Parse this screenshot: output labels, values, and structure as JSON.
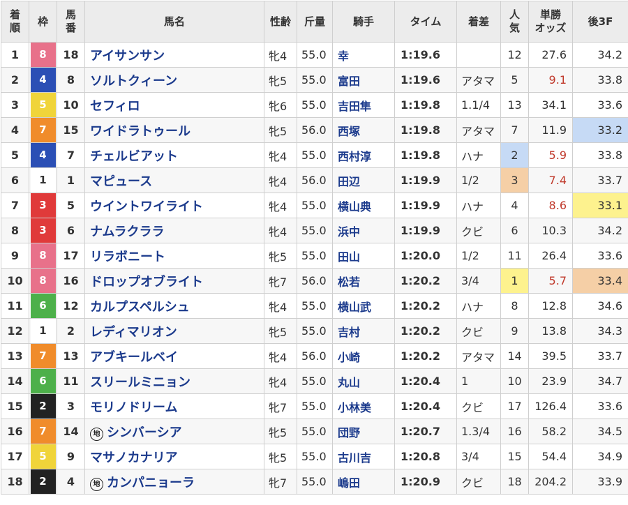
{
  "headers": {
    "rank": [
      "着",
      "順"
    ],
    "waku": "枠",
    "umaban": [
      "馬",
      "番"
    ],
    "horse": "馬名",
    "sex_age": "性齢",
    "weight": "斤量",
    "jockey": "騎手",
    "time": "タイム",
    "margin": "着差",
    "popularity": [
      "人",
      "気"
    ],
    "odds": [
      "単勝",
      "オッズ"
    ],
    "last3f": "後3F"
  },
  "chi_mark": "地",
  "waku_colors": {
    "1": {
      "bg": "#ffffff",
      "fg": "#333333"
    },
    "2": {
      "bg": "#222222",
      "fg": "#ffffff"
    },
    "3": {
      "bg": "#e03a3a",
      "fg": "#ffffff"
    },
    "4": {
      "bg": "#2b4fb5",
      "fg": "#ffffff"
    },
    "5": {
      "bg": "#f0d43a",
      "fg": "#ffffff"
    },
    "6": {
      "bg": "#4db04a",
      "fg": "#ffffff"
    },
    "7": {
      "bg": "#f08c2b",
      "fg": "#ffffff"
    },
    "8": {
      "bg": "#e8718a",
      "fg": "#ffffff"
    }
  },
  "highlight_colors": {
    "first": "#fdf28e",
    "second": "#c6daf5",
    "third": "#f5cfa6",
    "odds_red": "#c0392b"
  },
  "rows": [
    {
      "rank": "1",
      "waku": "8",
      "umaban": "18",
      "horse": "アイサンサン",
      "chi": false,
      "sex_age": "牝4",
      "weight": "55.0",
      "jockey": "幸",
      "time": "1:19.6",
      "margin": "",
      "pop": "12",
      "odds": "27.6",
      "odds_red": false,
      "last3f": "34.2",
      "pop_hl": "",
      "f3_hl": ""
    },
    {
      "rank": "2",
      "waku": "4",
      "umaban": "8",
      "horse": "ソルトクィーン",
      "chi": false,
      "sex_age": "牝5",
      "weight": "55.0",
      "jockey": "富田",
      "time": "1:19.6",
      "margin": "アタマ",
      "pop": "5",
      "odds": "9.1",
      "odds_red": true,
      "last3f": "33.8",
      "pop_hl": "",
      "f3_hl": ""
    },
    {
      "rank": "3",
      "waku": "5",
      "umaban": "10",
      "horse": "セフィロ",
      "chi": false,
      "sex_age": "牝6",
      "weight": "55.0",
      "jockey": "吉田隼",
      "time": "1:19.8",
      "margin": "1.1/4",
      "pop": "13",
      "odds": "34.1",
      "odds_red": false,
      "last3f": "33.6",
      "pop_hl": "",
      "f3_hl": ""
    },
    {
      "rank": "4",
      "waku": "7",
      "umaban": "15",
      "horse": "ワイドラトゥール",
      "chi": false,
      "sex_age": "牝5",
      "weight": "56.0",
      "jockey": "西塚",
      "time": "1:19.8",
      "margin": "アタマ",
      "pop": "7",
      "odds": "11.9",
      "odds_red": false,
      "last3f": "33.2",
      "pop_hl": "",
      "f3_hl": "second"
    },
    {
      "rank": "5",
      "waku": "4",
      "umaban": "7",
      "horse": "チェルビアット",
      "chi": false,
      "sex_age": "牝4",
      "weight": "55.0",
      "jockey": "西村淳",
      "time": "1:19.8",
      "margin": "ハナ",
      "pop": "2",
      "odds": "5.9",
      "odds_red": true,
      "last3f": "33.8",
      "pop_hl": "second",
      "f3_hl": ""
    },
    {
      "rank": "6",
      "waku": "1",
      "umaban": "1",
      "horse": "マピュース",
      "chi": false,
      "sex_age": "牝4",
      "weight": "56.0",
      "jockey": "田辺",
      "time": "1:19.9",
      "margin": "1/2",
      "pop": "3",
      "odds": "7.4",
      "odds_red": true,
      "last3f": "33.7",
      "pop_hl": "third",
      "f3_hl": ""
    },
    {
      "rank": "7",
      "waku": "3",
      "umaban": "5",
      "horse": "ウイントワイライト",
      "chi": false,
      "sex_age": "牝4",
      "weight": "55.0",
      "jockey": "横山典",
      "time": "1:19.9",
      "margin": "ハナ",
      "pop": "4",
      "odds": "8.6",
      "odds_red": true,
      "last3f": "33.1",
      "pop_hl": "",
      "f3_hl": "first"
    },
    {
      "rank": "8",
      "waku": "3",
      "umaban": "6",
      "horse": "ナムラクララ",
      "chi": false,
      "sex_age": "牝4",
      "weight": "55.0",
      "jockey": "浜中",
      "time": "1:19.9",
      "margin": "クビ",
      "pop": "6",
      "odds": "10.3",
      "odds_red": false,
      "last3f": "34.2",
      "pop_hl": "",
      "f3_hl": ""
    },
    {
      "rank": "9",
      "waku": "8",
      "umaban": "17",
      "horse": "リラボニート",
      "chi": false,
      "sex_age": "牝5",
      "weight": "55.0",
      "jockey": "田山",
      "time": "1:20.0",
      "margin": "1/2",
      "pop": "11",
      "odds": "26.4",
      "odds_red": false,
      "last3f": "33.6",
      "pop_hl": "",
      "f3_hl": ""
    },
    {
      "rank": "10",
      "waku": "8",
      "umaban": "16",
      "horse": "ドロップオブライト",
      "chi": false,
      "sex_age": "牝7",
      "weight": "56.0",
      "jockey": "松若",
      "time": "1:20.2",
      "margin": "3/4",
      "pop": "1",
      "odds": "5.7",
      "odds_red": true,
      "last3f": "33.4",
      "pop_hl": "first",
      "f3_hl": "third"
    },
    {
      "rank": "11",
      "waku": "6",
      "umaban": "12",
      "horse": "カルプスペルシュ",
      "chi": false,
      "sex_age": "牝4",
      "weight": "55.0",
      "jockey": "横山武",
      "time": "1:20.2",
      "margin": "ハナ",
      "pop": "8",
      "odds": "12.8",
      "odds_red": false,
      "last3f": "34.6",
      "pop_hl": "",
      "f3_hl": ""
    },
    {
      "rank": "12",
      "waku": "1",
      "umaban": "2",
      "horse": "レディマリオン",
      "chi": false,
      "sex_age": "牝5",
      "weight": "55.0",
      "jockey": "吉村",
      "time": "1:20.2",
      "margin": "クビ",
      "pop": "9",
      "odds": "13.8",
      "odds_red": false,
      "last3f": "34.3",
      "pop_hl": "",
      "f3_hl": ""
    },
    {
      "rank": "13",
      "waku": "7",
      "umaban": "13",
      "horse": "アブキールベイ",
      "chi": false,
      "sex_age": "牝4",
      "weight": "56.0",
      "jockey": "小崎",
      "time": "1:20.2",
      "margin": "アタマ",
      "pop": "14",
      "odds": "39.5",
      "odds_red": false,
      "last3f": "33.7",
      "pop_hl": "",
      "f3_hl": ""
    },
    {
      "rank": "14",
      "waku": "6",
      "umaban": "11",
      "horse": "スリールミニョン",
      "chi": false,
      "sex_age": "牝4",
      "weight": "55.0",
      "jockey": "丸山",
      "time": "1:20.4",
      "margin": "1",
      "pop": "10",
      "odds": "23.9",
      "odds_red": false,
      "last3f": "34.7",
      "pop_hl": "",
      "f3_hl": ""
    },
    {
      "rank": "15",
      "waku": "2",
      "umaban": "3",
      "horse": "モリノドリーム",
      "chi": false,
      "sex_age": "牝7",
      "weight": "55.0",
      "jockey": "小林美",
      "time": "1:20.4",
      "margin": "クビ",
      "pop": "17",
      "odds": "126.4",
      "odds_red": false,
      "last3f": "33.6",
      "pop_hl": "",
      "f3_hl": ""
    },
    {
      "rank": "16",
      "waku": "7",
      "umaban": "14",
      "horse": "シンバーシア",
      "chi": true,
      "sex_age": "牝5",
      "weight": "55.0",
      "jockey": "団野",
      "time": "1:20.7",
      "margin": "1.3/4",
      "pop": "16",
      "odds": "58.2",
      "odds_red": false,
      "last3f": "34.5",
      "pop_hl": "",
      "f3_hl": ""
    },
    {
      "rank": "17",
      "waku": "5",
      "umaban": "9",
      "horse": "マサノカナリア",
      "chi": false,
      "sex_age": "牝5",
      "weight": "55.0",
      "jockey": "古川吉",
      "time": "1:20.8",
      "margin": "3/4",
      "pop": "15",
      "odds": "54.4",
      "odds_red": false,
      "last3f": "34.9",
      "pop_hl": "",
      "f3_hl": ""
    },
    {
      "rank": "18",
      "waku": "2",
      "umaban": "4",
      "horse": "カンパニョーラ",
      "chi": true,
      "sex_age": "牝7",
      "weight": "55.0",
      "jockey": "嶋田",
      "time": "1:20.9",
      "margin": "クビ",
      "pop": "18",
      "odds": "204.2",
      "odds_red": false,
      "last3f": "33.9",
      "pop_hl": "",
      "f3_hl": ""
    }
  ]
}
